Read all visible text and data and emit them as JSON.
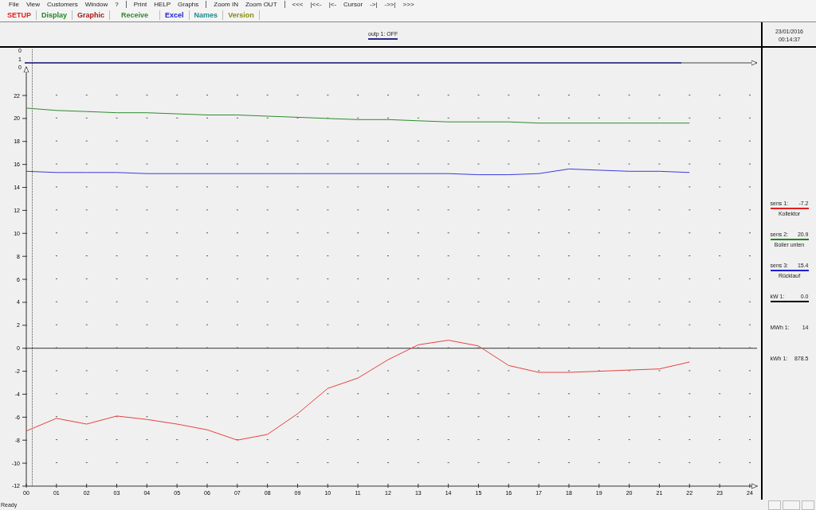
{
  "menu": [
    [
      "File",
      "View",
      "Customers",
      "Window",
      "?"
    ],
    [
      "Print",
      "HELP",
      "Graphs"
    ],
    [
      "Zoom IN",
      "Zoom OUT"
    ],
    [
      "<<<",
      "|<<-",
      "|<-",
      "Cursor",
      "->|",
      "->>|",
      ">>>"
    ]
  ],
  "tabs": [
    {
      "label": "SETUP",
      "color": "#e02020"
    },
    {
      "label": "Display",
      "color": "#1a8a1a"
    },
    {
      "label": "Graphic",
      "color": "#a01818"
    },
    {
      "label": "Receive",
      "color": "#2e8b2e"
    },
    {
      "label": "Excel",
      "color": "#2020d0"
    },
    {
      "label": "Names",
      "color": "#1a8a8a"
    },
    {
      "label": "Version",
      "color": "#8a8a10"
    }
  ],
  "chart_header": {
    "legend": [
      {
        "label": "outp 1: OFF",
        "color": "#2a2a8a"
      }
    ]
  },
  "timestamp": {
    "date": "23/01/2016",
    "time": "00:14:37"
  },
  "digital_axis": {
    "labels": [
      "0",
      "1",
      "0"
    ]
  },
  "chart_data": {
    "type": "line",
    "x": [
      0,
      1,
      2,
      3,
      4,
      5,
      6,
      7,
      8,
      9,
      10,
      11,
      12,
      13,
      14,
      15,
      16,
      17,
      18,
      19,
      20,
      21,
      22
    ],
    "series": [
      {
        "color": "#e84040",
        "values": [
          -7.2,
          -6.1,
          -6.6,
          -5.9,
          -6.2,
          -6.6,
          -7.1,
          -8.0,
          -7.5,
          -5.7,
          -3.5,
          -2.6,
          -1.0,
          0.3,
          0.7,
          0.2,
          -1.5,
          -2.1,
          -2.1,
          -2.0,
          -1.9,
          -1.8,
          -1.2
        ]
      },
      {
        "color": "#2e8b2e",
        "values": [
          20.9,
          20.7,
          20.6,
          20.5,
          20.5,
          20.4,
          20.3,
          20.3,
          20.2,
          20.1,
          20.0,
          19.9,
          19.9,
          19.8,
          19.7,
          19.7,
          19.7,
          19.6,
          19.6,
          19.6,
          19.6,
          19.6,
          19.6
        ]
      },
      {
        "color": "#3a3ae0",
        "values": [
          15.4,
          15.3,
          15.3,
          15.3,
          15.2,
          15.2,
          15.2,
          15.2,
          15.2,
          15.2,
          15.2,
          15.2,
          15.2,
          15.2,
          15.2,
          15.1,
          15.1,
          15.2,
          15.6,
          15.5,
          15.4,
          15.4,
          15.3
        ]
      }
    ],
    "xticks": [
      {
        "value": 0,
        "label": "00"
      },
      {
        "value": 1,
        "label": "01"
      },
      {
        "value": 2,
        "label": "02"
      },
      {
        "value": 3,
        "label": "03"
      },
      {
        "value": 4,
        "label": "04"
      },
      {
        "value": 5,
        "label": "05"
      },
      {
        "value": 6,
        "label": "06"
      },
      {
        "value": 7,
        "label": "07"
      },
      {
        "value": 8,
        "label": "08"
      },
      {
        "value": 9,
        "label": "09"
      },
      {
        "value": 10,
        "label": "10"
      },
      {
        "value": 11,
        "label": "11"
      },
      {
        "value": 12,
        "label": "12"
      },
      {
        "value": 13,
        "label": "13"
      },
      {
        "value": 14,
        "label": "14"
      },
      {
        "value": 15,
        "label": "15"
      },
      {
        "value": 16,
        "label": "16"
      },
      {
        "value": 17,
        "label": "17"
      },
      {
        "value": 18,
        "label": "18"
      },
      {
        "value": 19,
        "label": "19"
      },
      {
        "value": 20,
        "label": "20"
      },
      {
        "value": 21,
        "label": "21"
      },
      {
        "value": 22,
        "label": "22"
      },
      {
        "value": 23,
        "label": "23"
      },
      {
        "value": 24,
        "label": "24"
      }
    ],
    "yticks": [
      -12,
      -10,
      -8,
      -6,
      -4,
      -2,
      0,
      2,
      4,
      6,
      8,
      10,
      12,
      14,
      16,
      18,
      20,
      22
    ],
    "xlim": [
      0,
      24.25
    ],
    "ylim": [
      -12,
      24.5
    ]
  },
  "readouts": [
    {
      "label": "sens 1:",
      "value": "-7.2",
      "caption": "Kollektor",
      "color": "#e02020"
    },
    {
      "label": "sens 2:",
      "value": "20.9",
      "caption": "Boiler unten",
      "color": "#1a8a1a"
    },
    {
      "label": "sens 3:",
      "value": "15.4",
      "caption": "Rücklauf",
      "color": "#2020d0"
    },
    {
      "label": "kW 1:",
      "value": "0.0",
      "color": "#000000"
    },
    {
      "label": "MWh 1:",
      "value": "14"
    },
    {
      "label": "kWh 1:",
      "value": "878.5"
    }
  ],
  "status_bar": {
    "text": "Ready"
  }
}
